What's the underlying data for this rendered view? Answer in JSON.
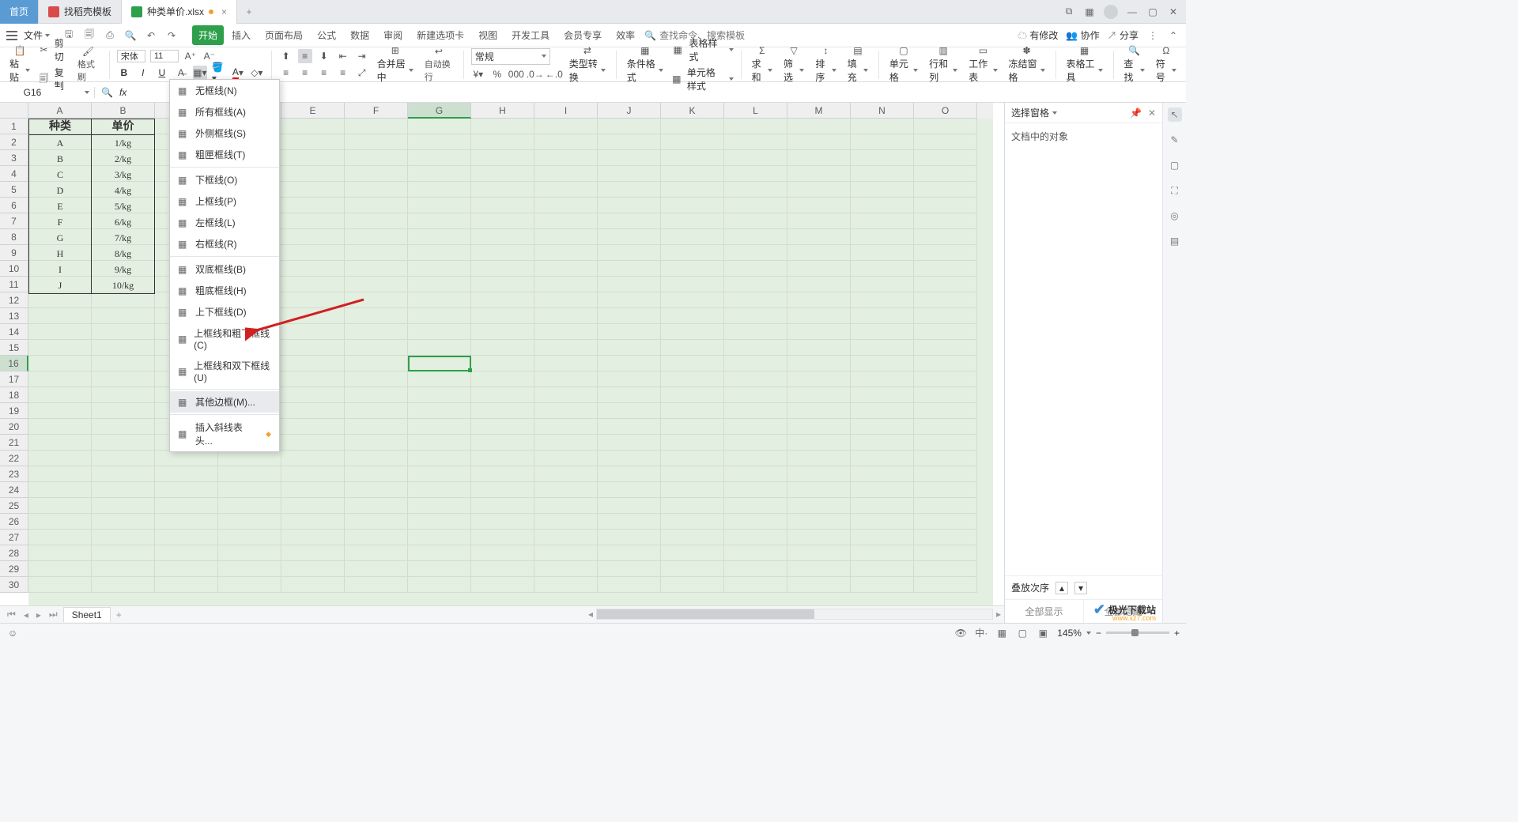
{
  "titlebar": {
    "home": "首页",
    "tab1": "找稻壳模板",
    "tab2": "种类单价.xlsx"
  },
  "menubar": {
    "file": "文件",
    "tabs": [
      "开始",
      "插入",
      "页面布局",
      "公式",
      "数据",
      "审阅",
      "新建选项卡",
      "视图",
      "开发工具",
      "会员专享",
      "效率"
    ],
    "search_cmd": "查找命令、搜索模板",
    "right": {
      "changes": "有修改",
      "collab": "协作",
      "share": "分享"
    }
  },
  "ribbon": {
    "paste": "粘贴",
    "cut": "剪切",
    "copy": "复制",
    "painter": "格式刷",
    "font": "宋体",
    "size": "11",
    "merge": "合并居中",
    "wrap": "自动换行",
    "numfmt": "常规",
    "typeconv": "类型转换",
    "condf": "条件格式",
    "tablestyle": "表格样式",
    "cellstyle": "单元格样式",
    "sum": "求和",
    "filter": "筛选",
    "sort": "排序",
    "fill": "填充",
    "cell": "单元格",
    "rowcol": "行和列",
    "sheet": "工作表",
    "freeze": "冻结窗格",
    "tabletools": "表格工具",
    "find": "查找",
    "symbol": "符号"
  },
  "formula": {
    "name": "G16"
  },
  "columns": [
    "A",
    "B",
    "C",
    "D",
    "E",
    "F",
    "G",
    "H",
    "I",
    "J",
    "K",
    "L",
    "M",
    "N",
    "O"
  ],
  "headers": {
    "c1": "种类",
    "c2": "单价"
  },
  "rows": [
    {
      "c1": "A",
      "c2": "1/kg"
    },
    {
      "c1": "B",
      "c2": "2/kg"
    },
    {
      "c1": "C",
      "c2": "3/kg"
    },
    {
      "c1": "D",
      "c2": "4/kg"
    },
    {
      "c1": "E",
      "c2": "5/kg"
    },
    {
      "c1": "F",
      "c2": "6/kg"
    },
    {
      "c1": "G",
      "c2": "7/kg"
    },
    {
      "c1": "H",
      "c2": "8/kg"
    },
    {
      "c1": "I",
      "c2": "9/kg"
    },
    {
      "c1": "J",
      "c2": "10/kg"
    }
  ],
  "dropdown": {
    "items": [
      "无框线(N)",
      "所有框线(A)",
      "外侧框线(S)",
      "粗匣框线(T)",
      "",
      "下框线(O)",
      "上框线(P)",
      "左框线(L)",
      "右框线(R)",
      "",
      "双底框线(B)",
      "粗底框线(H)",
      "上下框线(D)",
      "上框线和粗下框线(C)",
      "上框线和双下框线(U)",
      "",
      "其他边框(M)...",
      "",
      "插入斜线表头..."
    ],
    "hover_index": 16
  },
  "panel": {
    "title": "选择窗格",
    "sub": "文档中的对象",
    "order": "叠放次序",
    "showall": "全部显示",
    "hideall": "全部隐藏"
  },
  "sheettab": "Sheet1",
  "status": {
    "zoom": "145%"
  },
  "watermark": {
    "t1": "极光下载站",
    "t2": "www.xz7.com"
  },
  "selected": {
    "col": "G",
    "row": 16
  }
}
